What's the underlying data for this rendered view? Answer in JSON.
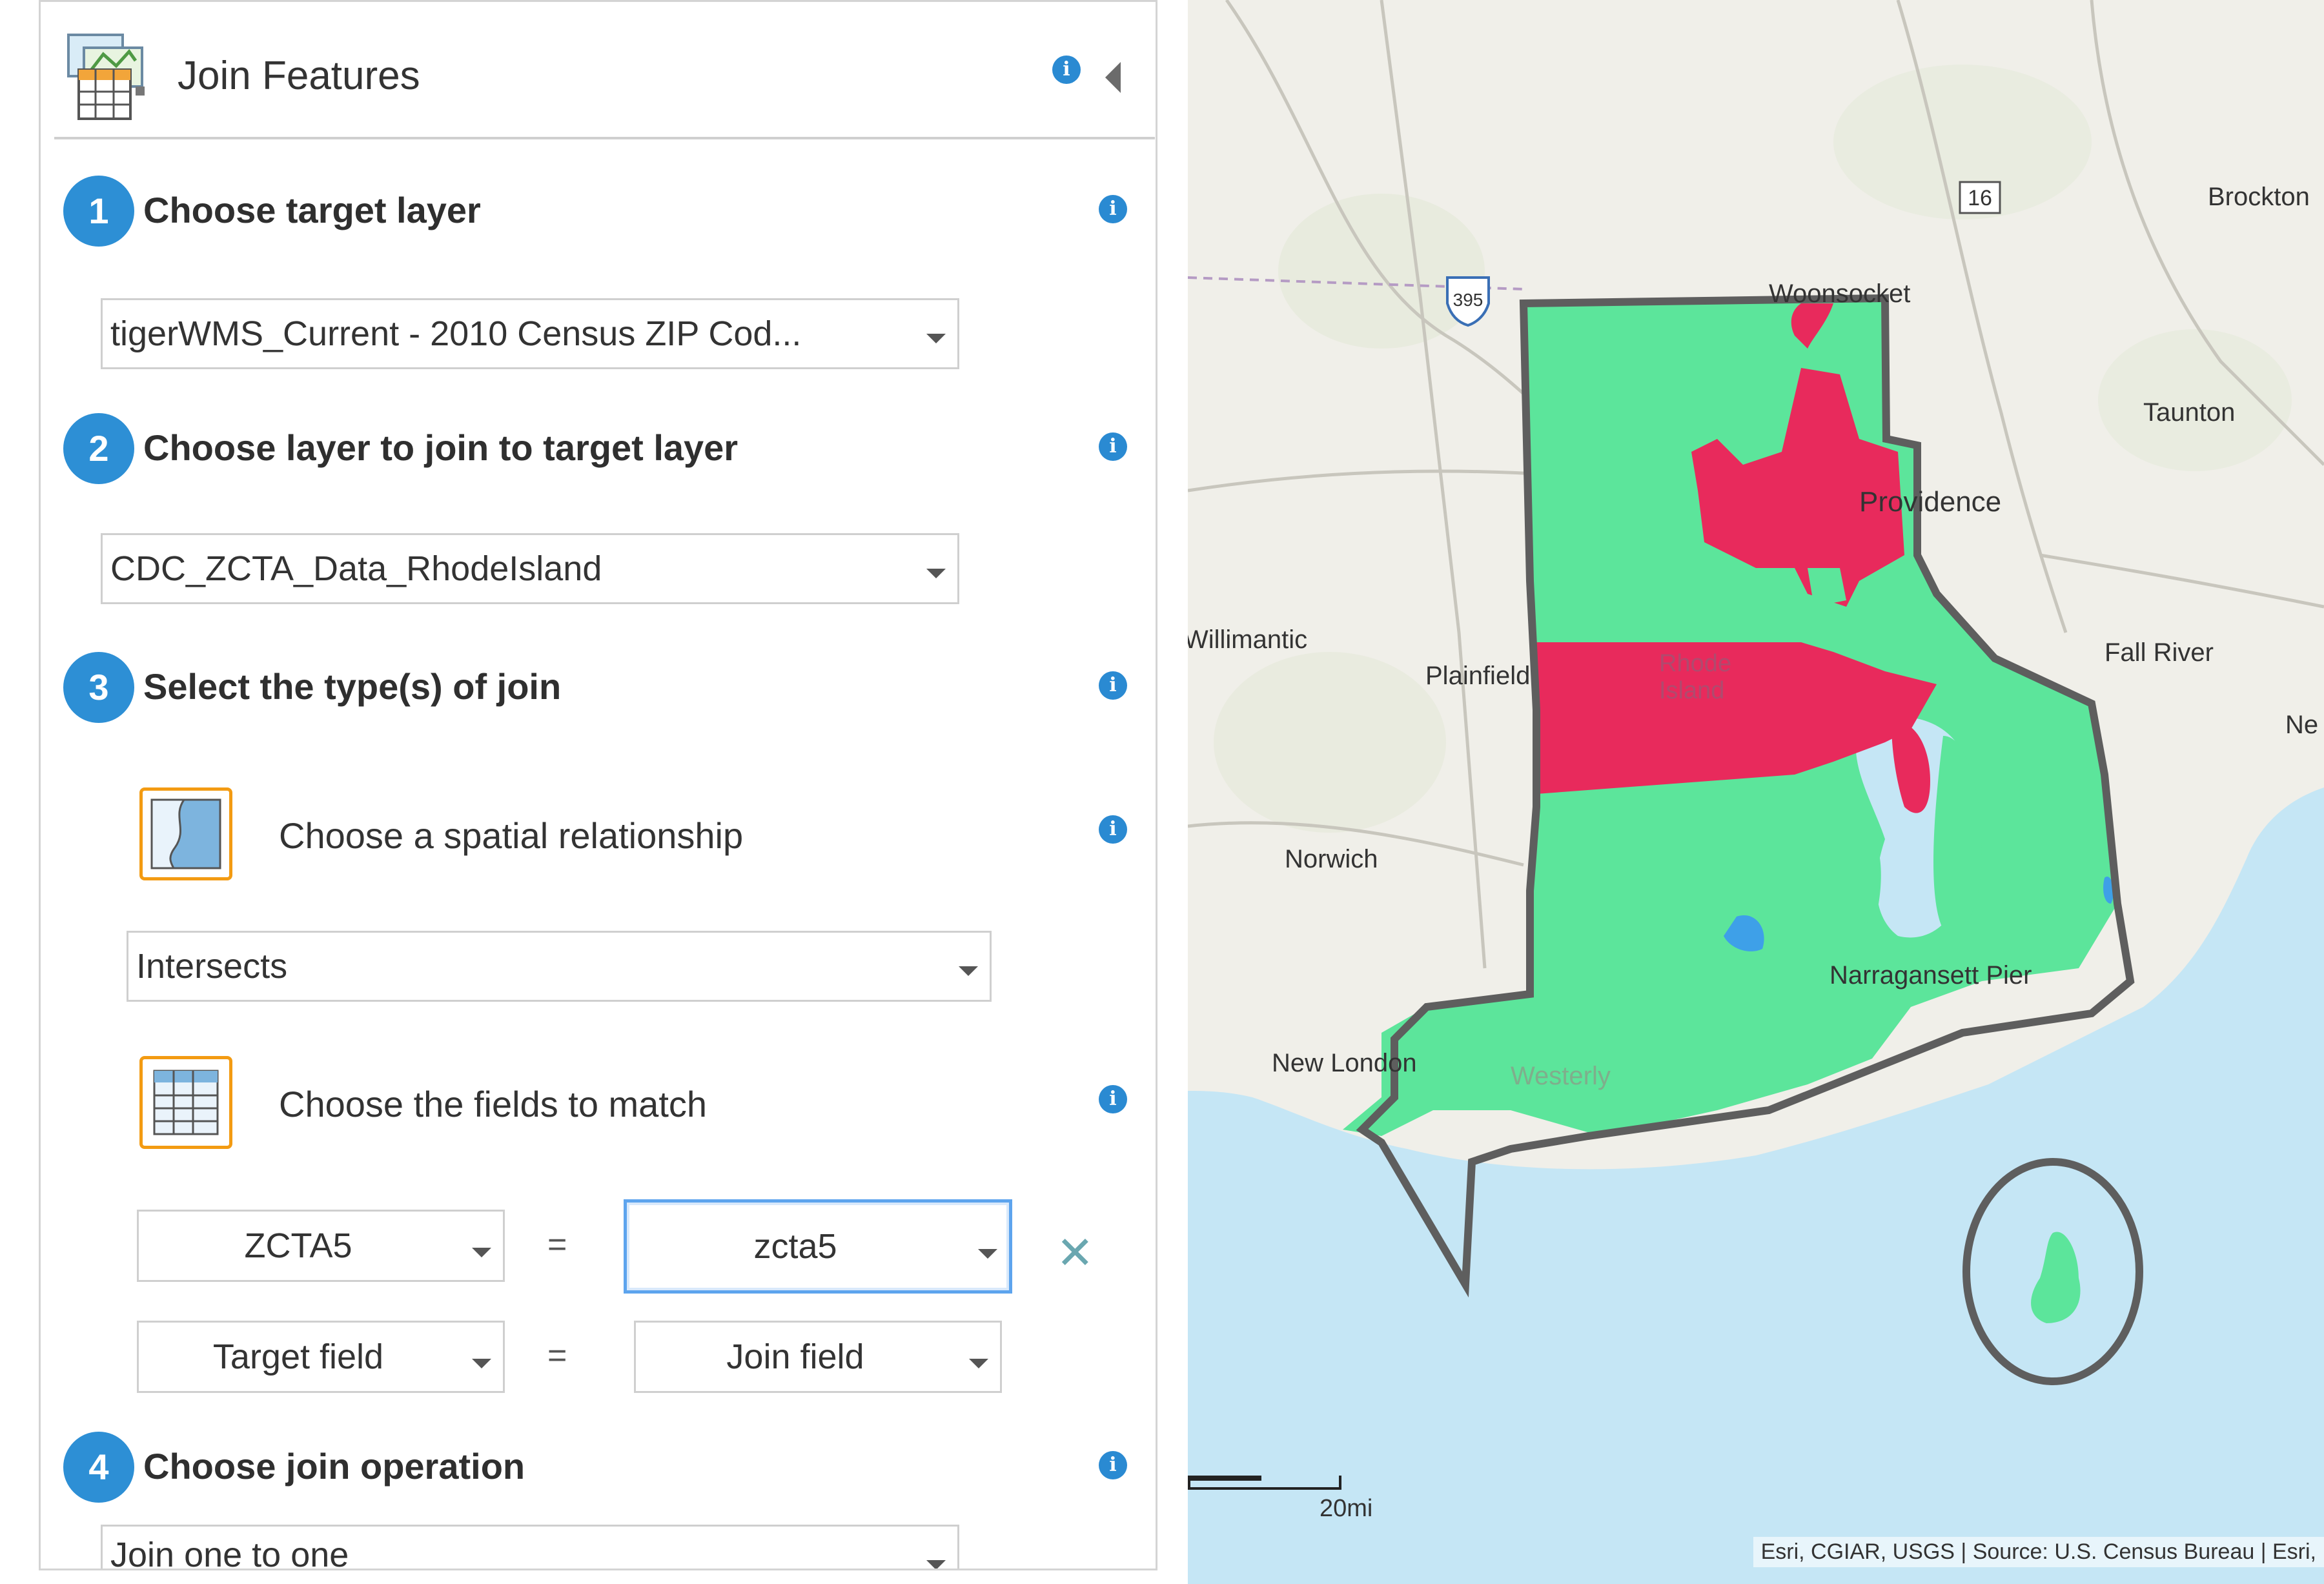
{
  "panel": {
    "title": "Join Features",
    "icon": "join-features-icon",
    "steps": [
      {
        "number": "1",
        "label": "Choose target layer",
        "value": "tigerWMS_Current - 2010 Census ZIP Cod..."
      },
      {
        "number": "2",
        "label": "Choose layer to join to target layer",
        "value": "CDC_ZCTA_Data_RhodeIsland"
      },
      {
        "number": "3",
        "label": "Select the type(s) of join"
      },
      {
        "number": "4",
        "label": "Choose join operation",
        "value": "Join one to one"
      }
    ],
    "spatial": {
      "label": "Choose a spatial relationship",
      "icon": "spatial-relationship-icon",
      "value": "Intersects"
    },
    "fields": {
      "label": "Choose the fields to match",
      "icon": "table-fields-icon",
      "rows": [
        {
          "target": "ZCTA5",
          "eq": "=",
          "join": "zcta5"
        },
        {
          "target": "Target field",
          "eq": "=",
          "join": "Join field"
        }
      ],
      "remove_icon": "close-icon"
    },
    "info_icon": "info-icon",
    "colors": {
      "accent": "#2d8fd5",
      "highlight": "#f39b12"
    }
  },
  "map": {
    "labels": {
      "brockton": "Brockton",
      "woonsocket": "Woonsocket",
      "taunton": "Taunton",
      "providence": "Providence",
      "willimantic": "Willimantic",
      "plainfield": "Plainfield",
      "fall_river": "Fall River",
      "ne": "Ne",
      "rhode": "Rhode",
      "island": "Island",
      "norwich": "Norwich",
      "narragansett": "Narragansett Pier",
      "new_london": "New London",
      "westerly": "Westerly",
      "shield_16": "16",
      "shield_395": "395"
    },
    "scale": "20mi",
    "attribution": "Esri, CGIAR, USGS | Source: U.S. Census Bureau | Esri,",
    "colors": {
      "green": "#5ce59b",
      "red": "#e82a5c",
      "water": "#c5e6f5",
      "land": "#f1f0ea"
    }
  }
}
